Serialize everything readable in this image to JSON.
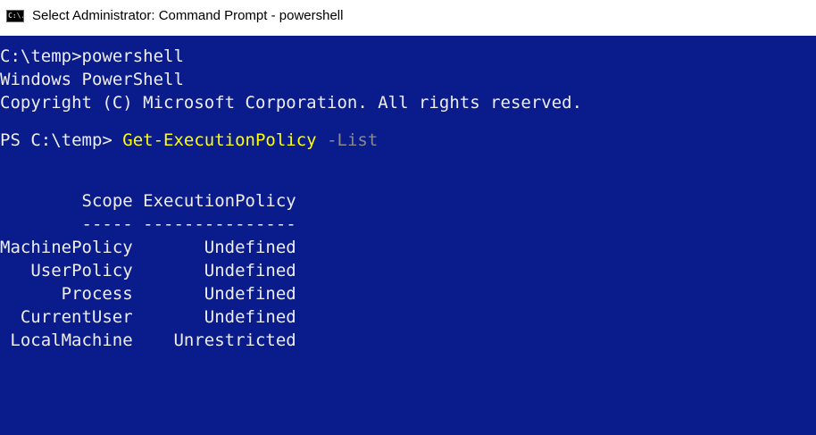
{
  "window": {
    "title": "Select Administrator: Command Prompt - powershell",
    "icon_label": "C:\\."
  },
  "console": {
    "lines": [
      "C:\\temp>powershell",
      "Windows PowerShell",
      "Copyright (C) Microsoft Corporation. All rights reserved."
    ],
    "prompt": {
      "prefix": "PS C:\\temp> ",
      "command": "Get-ExecutionPolicy",
      "parameter": " -List"
    },
    "table": {
      "header": "        Scope ExecutionPolicy",
      "separator": "        ----- ---------------",
      "rows": [
        {
          "scope": "MachinePolicy",
          "policy": "Undefined"
        },
        {
          "scope": "UserPolicy",
          "policy": "Undefined"
        },
        {
          "scope": "Process",
          "policy": "Undefined"
        },
        {
          "scope": "CurrentUser",
          "policy": "Undefined"
        },
        {
          "scope": "LocalMachine",
          "policy": "Unrestricted"
        }
      ]
    },
    "colors": {
      "background": "#0a1c8c",
      "text": "#eeedf0",
      "command": "#ffff00",
      "parameter": "#8a8a8a"
    }
  }
}
